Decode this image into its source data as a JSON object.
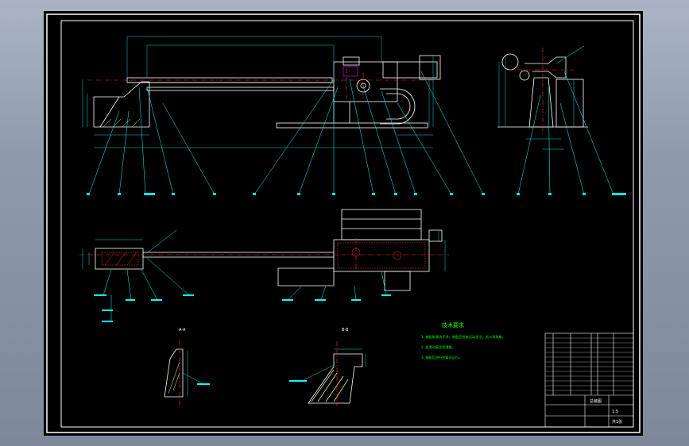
{
  "app": {
    "type": "CAD drawing viewer",
    "background_colors": {
      "frame_top": "#aab4c4",
      "frame_bottom": "#7d889b",
      "paper": "#000000",
      "border": "#ffffff"
    }
  },
  "colors": {
    "part_outline": "#ffffff",
    "dimension": "#00d4d4",
    "leader": "#00ffff",
    "centerline": "#ff3030",
    "hatch": "#ffff99",
    "notes": "#00ff00",
    "highlight": "#ff00ff"
  },
  "views": {
    "section_a_label": "A-A",
    "section_b_label": "B-B"
  },
  "notes": {
    "title": "技术要求",
    "lines": [
      "1. 装配前清洗干净，装配后检查运动灵活，无卡滞现象。",
      "2. 各滑动面涂润滑脂。",
      "3. 装配后进行空载试运行。"
    ]
  },
  "title_block": {
    "drawing_name": "总装图",
    "scale": "1:5",
    "sheet": "共1张"
  },
  "icons": [
    "balloon-callout-icon",
    "centerline-icon",
    "hatch-pattern-icon"
  ]
}
